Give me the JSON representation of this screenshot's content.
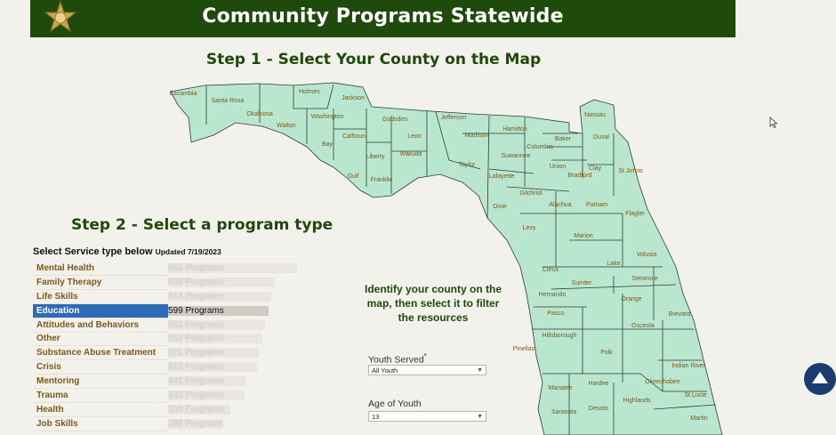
{
  "header": {
    "title": "Community Programs Statewide"
  },
  "step1": "Step 1 - Select Your County on the Map",
  "step2": "Step 2 - Select a program type",
  "service": {
    "heading": "Select Service type below",
    "updated": "Updated 7/19/2023",
    "items": [
      {
        "label": "Mental Health",
        "count": "951 Programs",
        "share": 1.0
      },
      {
        "label": "Family Therapy",
        "count": "638 Programs",
        "share": 0.83
      },
      {
        "label": "Life Skills",
        "count": "614 Programs",
        "share": 0.8
      },
      {
        "label": "Education",
        "count": "599 Programs",
        "share": 0.78,
        "selected": true
      },
      {
        "label": "Attitudes and Behaviors",
        "count": "561 Programs",
        "share": 0.75
      },
      {
        "label": "Other",
        "count": "552 Programs",
        "share": 0.73
      },
      {
        "label": "Substance Abuse Treatment",
        "count": "521 Programs",
        "share": 0.7
      },
      {
        "label": "Crisis",
        "count": "513 Programs",
        "share": 0.69
      },
      {
        "label": "Mentoring",
        "count": "441 Programs",
        "share": 0.6
      },
      {
        "label": "Trauma",
        "count": "433 Programs",
        "share": 0.59
      },
      {
        "label": "Health",
        "count": "339 Programs",
        "share": 0.48
      },
      {
        "label": "Job Skills",
        "count": "288 Programs",
        "share": 0.42
      }
    ]
  },
  "instructions": "Identify your county on the map, then select it to filter the resources",
  "filters": {
    "youth_served": {
      "label": "Youth Served",
      "required": "*",
      "value": "All Youth"
    },
    "age_of_youth": {
      "label": "Age of Youth",
      "value": "13"
    }
  },
  "map": {
    "fill": "#b9e6cf",
    "counties": [
      {
        "name": "Escambia"
      },
      {
        "name": "Santa Rosa"
      },
      {
        "name": "Okaloosa"
      },
      {
        "name": "Walton"
      },
      {
        "name": "Holmes"
      },
      {
        "name": "Washington"
      },
      {
        "name": "Jackson"
      },
      {
        "name": "Bay"
      },
      {
        "name": "Calhoun"
      },
      {
        "name": "Gadsden"
      },
      {
        "name": "Leon"
      },
      {
        "name": "Jefferson"
      },
      {
        "name": "Madison"
      },
      {
        "name": "Hamilton"
      },
      {
        "name": "Columbia"
      },
      {
        "name": "Baker"
      },
      {
        "name": "Nassau"
      },
      {
        "name": "Duval"
      },
      {
        "name": "Liberty"
      },
      {
        "name": "Wakulla"
      },
      {
        "name": "Gulf"
      },
      {
        "name": "Franklin"
      },
      {
        "name": "Taylor"
      },
      {
        "name": "Suwannee"
      },
      {
        "name": "Lafayette"
      },
      {
        "name": "Union"
      },
      {
        "name": "Bradford"
      },
      {
        "name": "Clay"
      },
      {
        "name": "St Johns"
      },
      {
        "name": "Gilchrist"
      },
      {
        "name": "Dixie"
      },
      {
        "name": "Alachua"
      },
      {
        "name": "Putnam"
      },
      {
        "name": "Flagler"
      },
      {
        "name": "Levy"
      },
      {
        "name": "Marion"
      },
      {
        "name": "Volusia"
      },
      {
        "name": "Lake"
      },
      {
        "name": "Citrus"
      },
      {
        "name": "Sumter"
      },
      {
        "name": "Seminole"
      },
      {
        "name": "Hernando"
      },
      {
        "name": "Orange"
      },
      {
        "name": "Pasco"
      },
      {
        "name": "Brevard"
      },
      {
        "name": "Osceola"
      },
      {
        "name": "Hillsborough"
      },
      {
        "name": "Pinellas"
      },
      {
        "name": "Polk"
      },
      {
        "name": "Indian River"
      },
      {
        "name": "Manatee"
      },
      {
        "name": "Hardee"
      },
      {
        "name": "Okeechobee"
      },
      {
        "name": "St Lucie"
      },
      {
        "name": "Highlands"
      },
      {
        "name": "Sarasota"
      },
      {
        "name": "Desoto"
      },
      {
        "name": "Martin"
      }
    ]
  },
  "icons": {
    "badge": "sheriff-star-icon",
    "scroll_top": "arrow-up-icon",
    "cursor": "mouse-cursor-icon"
  }
}
